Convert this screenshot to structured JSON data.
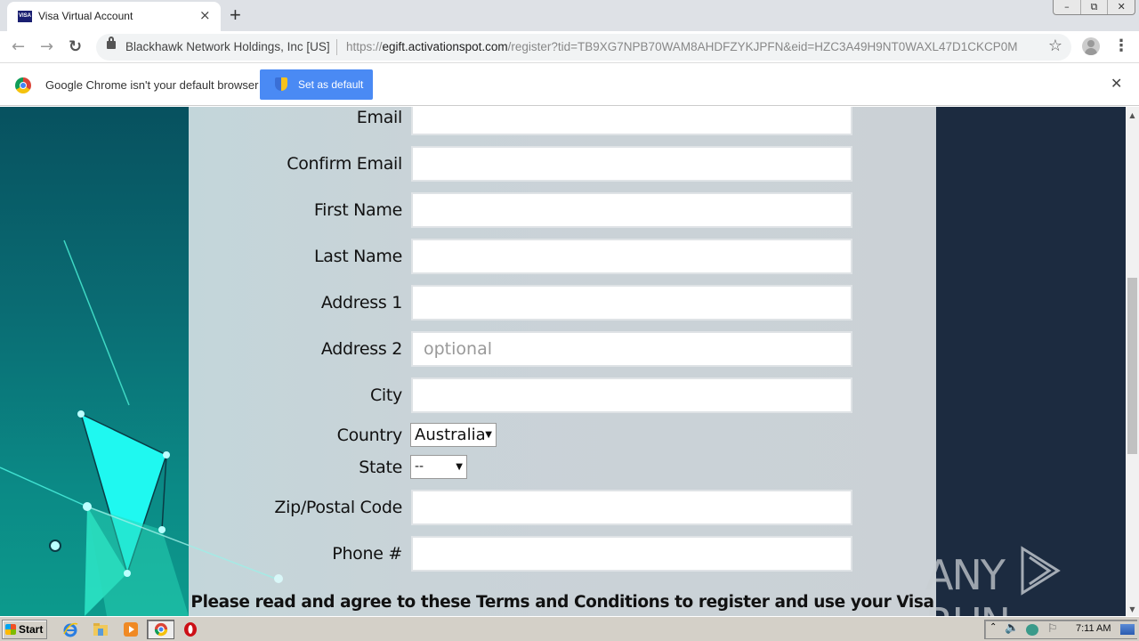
{
  "browser": {
    "tab": {
      "title": "Visa Virtual Account",
      "favicon": "VISA",
      "close_icon": "×"
    },
    "new_tab_icon": "+",
    "window_controls": {
      "minimize": "–",
      "restore": "⧉",
      "close": "✕"
    },
    "nav": {
      "back_icon": "←",
      "forward_icon": "→",
      "reload_icon": "↻"
    },
    "address_bar": {
      "org": "Blackhawk Network Holdings, Inc [US]",
      "url_scheme": "https://",
      "url_host": "egift.activationspot.com",
      "url_path": "/register?tid=TB9XG7NPB70WAM8AHDFZYKJPFN&eid=HZC3A49H9NT0WAXL47D1CKCP0M",
      "star_icon": "☆"
    },
    "menu_icon": "⋮"
  },
  "infobar": {
    "message": "Google Chrome isn't your default browser",
    "button_label": "Set as default",
    "close_icon": "✕"
  },
  "form": {
    "fields": [
      {
        "label": "Email",
        "value": "",
        "placeholder": ""
      },
      {
        "label": "Confirm Email",
        "value": "",
        "placeholder": ""
      },
      {
        "label": "First Name",
        "value": "",
        "placeholder": ""
      },
      {
        "label": "Last Name",
        "value": "",
        "placeholder": ""
      },
      {
        "label": "Address 1",
        "value": "",
        "placeholder": ""
      },
      {
        "label": "Address 2",
        "value": "",
        "placeholder": "optional"
      },
      {
        "label": "City",
        "value": "",
        "placeholder": ""
      }
    ],
    "country": {
      "label": "Country",
      "selected": "Australia"
    },
    "state": {
      "label": "State",
      "selected": "--"
    },
    "fields2": [
      {
        "label": "Zip/Postal Code",
        "value": "",
        "placeholder": ""
      },
      {
        "label": "Phone #",
        "value": "",
        "placeholder": ""
      }
    ],
    "terms_text": "Please read and agree to these Terms and Conditions to register and use your Visa"
  },
  "watermark": {
    "left": "ANY",
    "right": "RUN"
  },
  "taskbar": {
    "start_label": "Start",
    "clock": "7:11 AM"
  }
}
